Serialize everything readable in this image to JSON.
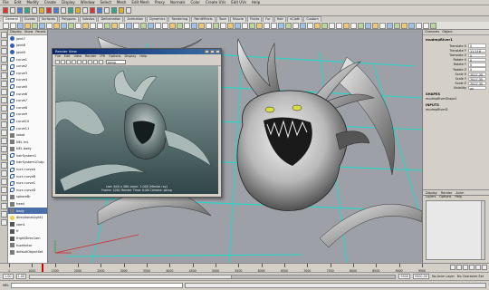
{
  "menubar": {
    "items": [
      "File",
      "Edit",
      "Modify",
      "Create",
      "Display",
      "Window",
      "Select",
      "Mesh",
      "Edit Mesh",
      "Proxy",
      "Normals",
      "Color",
      "Create UVs",
      "Edit UVs",
      "Help"
    ]
  },
  "shelf": {
    "tabs": [
      "General",
      "Curves",
      "Surfaces",
      "Polygons",
      "Subdivs",
      "Deformation",
      "Animation",
      "Dynamics",
      "Rendering",
      "PaintEffects",
      "Toon",
      "Muscle",
      "Fluids",
      "Fur",
      "Hair",
      "nCloth",
      "Custom"
    ],
    "active_tab": "General"
  },
  "outliner": {
    "menu": [
      "Display",
      "Show",
      "Panels"
    ],
    "items": [
      {
        "label": "joint7",
        "icon": "joint"
      },
      {
        "label": "joint8",
        "icon": "joint"
      },
      {
        "label": "joint9",
        "icon": "joint"
      },
      {
        "label": "curve1",
        "icon": "curve"
      },
      {
        "label": "curve2",
        "icon": "curve"
      },
      {
        "label": "curve3",
        "icon": "curve"
      },
      {
        "label": "curve4",
        "icon": "curve"
      },
      {
        "label": "curve5",
        "icon": "curve"
      },
      {
        "label": "curve6",
        "icon": "curve"
      },
      {
        "label": "curve7",
        "icon": "curve"
      },
      {
        "label": "curve8",
        "icon": "curve"
      },
      {
        "label": "curve9",
        "icon": "curve"
      },
      {
        "label": "curve10",
        "icon": "curve"
      },
      {
        "label": "curve11",
        "icon": "curve"
      },
      {
        "label": "robot",
        "icon": "mesh"
      },
      {
        "label": "NEL hrs",
        "icon": "mesh"
      },
      {
        "label": "NEL body",
        "icon": "mesh"
      },
      {
        "label": "hairSystem1",
        "icon": "curve"
      },
      {
        "label": "hairSystem1Outp",
        "icon": "curve"
      },
      {
        "label": "nurs curveA",
        "icon": "curve"
      },
      {
        "label": "nurs curveB",
        "icon": "curve"
      },
      {
        "label": "nurs curveC",
        "icon": "curve"
      },
      {
        "label": "nurs curveD",
        "icon": "curve"
      },
      {
        "label": "sphereBr",
        "icon": "mesh"
      },
      {
        "label": "head",
        "icon": "mesh"
      },
      {
        "label": "body",
        "icon": "mesh"
      },
      {
        "label": "directionalLight1",
        "icon": "light"
      },
      {
        "label": "cam1",
        "icon": "cam"
      },
      {
        "label": "fr",
        "icon": "cam"
      },
      {
        "label": "frightDirecCam",
        "icon": "cam"
      },
      {
        "label": "fuzzfactor",
        "icon": "mesh"
      },
      {
        "label": "defaultObjectSet",
        "icon": "mesh"
      }
    ],
    "selected_index": 25
  },
  "render_view": {
    "title": "Render View",
    "menu": [
      "File",
      "Edit",
      "View",
      "Render",
      "IPR",
      "Options",
      "Display",
      "Help"
    ],
    "camera_field": "persp",
    "info_lines": [
      "size: 640 x 480  zoom: 1.000    (Mental ray)",
      "Frame: 1001        Render Time: 0:06     Camera: persp"
    ]
  },
  "channel_box": {
    "menu": [
      "Channels",
      "Object"
    ],
    "object_name": "mudmpRiver1",
    "channels": [
      {
        "label": "Translate X",
        "value": "0"
      },
      {
        "label": "Translate Y",
        "value": "11.216"
      },
      {
        "label": "Translate Z",
        "value": "0"
      },
      {
        "label": "Rotate X",
        "value": "0"
      },
      {
        "label": "Rotate Y",
        "value": "0"
      },
      {
        "label": "Rotate Z",
        "value": "0"
      },
      {
        "label": "Scale X",
        "value": "7017.35"
      },
      {
        "label": "Scale Y",
        "value": "7017.35"
      },
      {
        "label": "Scale Z",
        "value": "7017.35"
      },
      {
        "label": "Visibility",
        "value": "on"
      }
    ],
    "shapes_label": "SHAPES",
    "shape_name": "mudmpRiverShape1",
    "inputs_label": "INPUTS",
    "input_name": "mudmpRiverD",
    "layer_tabs": [
      "Display",
      "Render",
      "Anim"
    ],
    "layer_menu": [
      "Layers",
      "Options",
      "Help"
    ]
  },
  "timeline": {
    "ticks": [
      "1",
      "1000",
      "1500",
      "2000",
      "2500",
      "3000",
      "3500",
      "4000",
      "4500",
      "5000",
      "5500",
      "6000",
      "6500",
      "7000",
      "7500",
      "8000",
      "8500",
      "9000",
      "9500"
    ],
    "current_frame_fraction": 0.08
  },
  "range": {
    "start": "1.00",
    "inner_start": "1.00",
    "inner_end": "9500",
    "end": "9500.00",
    "layer_label": "No Anim Layer",
    "char_label": "No Character Set"
  },
  "command": {
    "mel_label": "MEL"
  },
  "colors": {
    "grid": "#25d8c8",
    "titlebar": "#0a246a",
    "selection": "#4a6ea8"
  }
}
